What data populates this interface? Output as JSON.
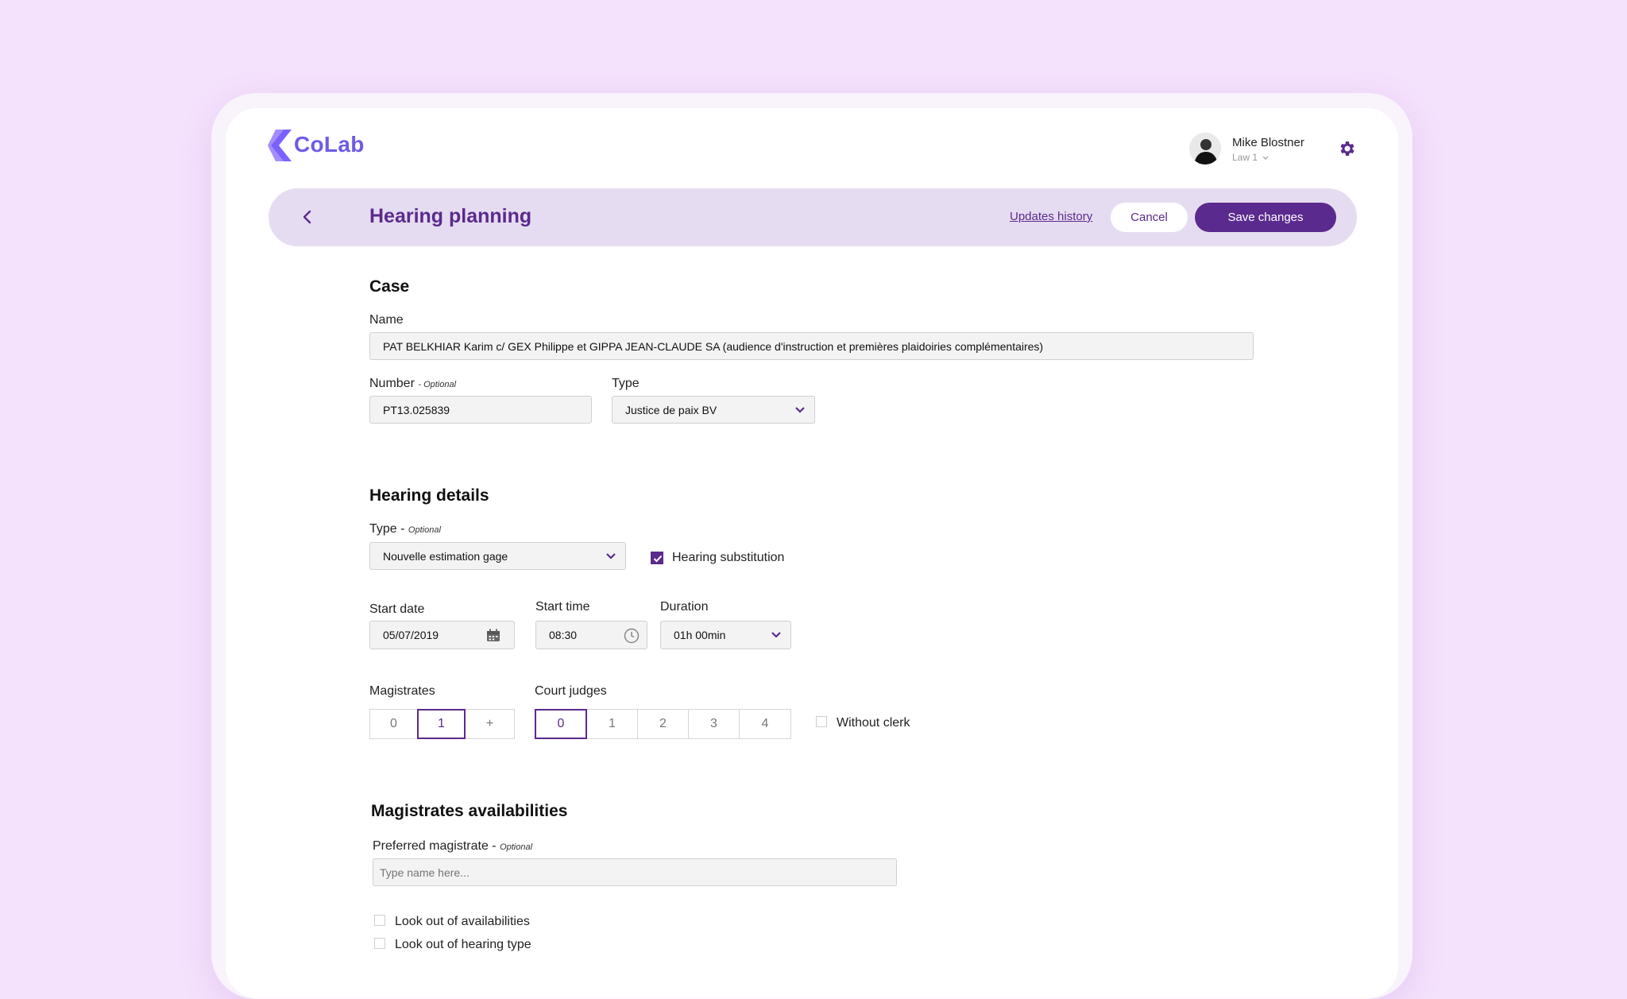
{
  "app": {
    "name": "CoLab",
    "brand_color": "#5b2a8e",
    "logo_color": "#6c5ce7"
  },
  "user": {
    "name": "Mike Blostner",
    "org": "Law 1"
  },
  "header": {
    "title": "Hearing planning",
    "history_link": "Updates history",
    "cancel_label": "Cancel",
    "save_label": "Save changes"
  },
  "case": {
    "title": "Case",
    "name_label": "Name",
    "name_value": "PAT BELKHIAR Karim c/ GEX Philippe et GIPPA JEAN-CLAUDE SA (audience d'instruction et premières plaidoiries complémentaires)",
    "number_label": "Number",
    "number_optional": "- Optional",
    "number_value": "PT13.025839",
    "type_label": "Type",
    "type_value": "Justice de paix BV"
  },
  "hearing": {
    "title": "Hearing details",
    "type_label": "Type -",
    "type_optional": "Optional",
    "type_value": "Nouvelle estimation gage",
    "substitution_label": "Hearing substitution",
    "substitution_checked": true,
    "start_date_label": "Start date",
    "start_date_value": "05/07/2019",
    "start_time_label": "Start time",
    "start_time_value": "08:30",
    "duration_label": "Duration",
    "duration_value": "01h 00min",
    "magistrates_label": "Magistrates",
    "magistrates_options": [
      "0",
      "1",
      "+"
    ],
    "magistrates_selected": "1",
    "court_judges_label": "Court judges",
    "court_judges_options": [
      "0",
      "1",
      "2",
      "3",
      "4"
    ],
    "court_judges_selected": "0",
    "without_clerk_label": "Without clerk",
    "without_clerk_checked": false
  },
  "availabilities": {
    "title": "Magistrates availabilities",
    "preferred_label": "Preferred magistrate -",
    "preferred_optional": "Optional",
    "preferred_placeholder": "Type name here...",
    "look_out_availabilities": "Look out of availabilities",
    "look_out_hearing_type": "Look out of hearing type"
  },
  "icons": {
    "logo": "colab-logo-icon",
    "back": "chevron-left-icon",
    "settings": "gear-icon",
    "calendar": "calendar-icon",
    "clock": "clock-icon",
    "dropdown": "chevron-down-icon"
  }
}
